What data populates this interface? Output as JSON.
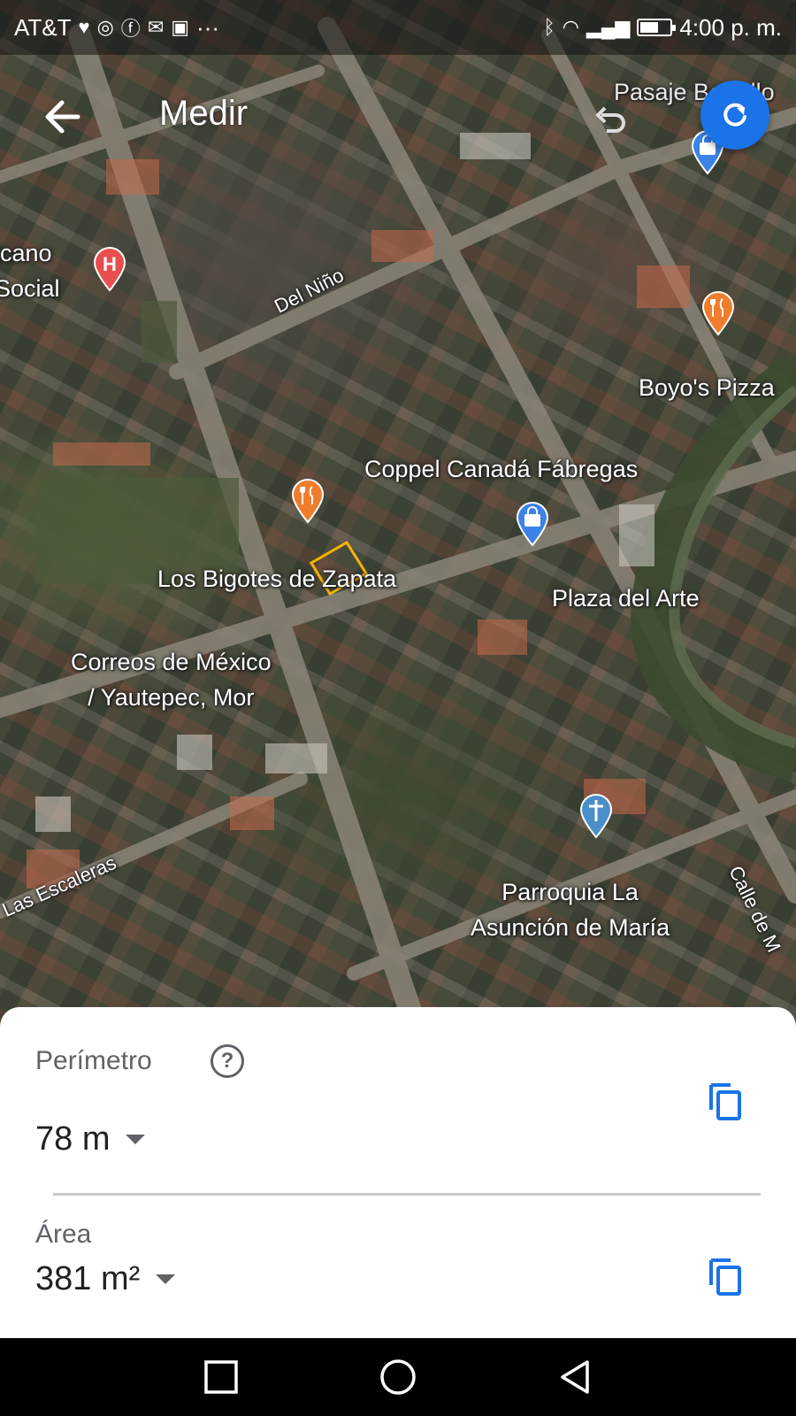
{
  "status_bar": {
    "carrier": "AT&T",
    "more": "···",
    "time": "4:00 p. m."
  },
  "app_bar": {
    "title": "Medir"
  },
  "map": {
    "places": [
      {
        "id": "hospital",
        "label_lines": [
          "icano",
          "Social"
        ],
        "icon": "hospital-pin-icon",
        "color": "#e94e4e"
      },
      {
        "id": "boyos",
        "label": "Boyo's Pizza",
        "icon": "restaurant-pin-icon",
        "color": "#f07d2c"
      },
      {
        "id": "coppel",
        "label": "Coppel Canadá Fábregas",
        "icon": "shopping-pin-icon",
        "color": "#3c82e8"
      },
      {
        "id": "bigotes",
        "label": "Los Bigotes de Zapata",
        "icon": "restaurant-pin-icon",
        "color": "#f07d2c"
      },
      {
        "id": "plaza",
        "label": "Plaza del Arte"
      },
      {
        "id": "correos",
        "label_lines": [
          "Correos de México",
          "/ Yautepec, Mor"
        ]
      },
      {
        "id": "parroquia",
        "label_lines": [
          "Parroquia La",
          "Asunción de María"
        ],
        "icon": "church-pin-icon",
        "color": "#4a8fc9"
      },
      {
        "id": "pasaje",
        "label": "Pasaje Bertello",
        "icon": "shopping-pin-icon",
        "color": "#3c82e8"
      }
    ],
    "streets": {
      "del_nino": "Del Niño",
      "las_escaleras": "Las Escaleras",
      "calle_de": "Calle de M"
    },
    "measured_shape_color": "#f4b400"
  },
  "measurement": {
    "perimeter_label": "Perímetro",
    "perimeter_value": "78 m",
    "area_label": "Área",
    "area_value": "381 m²",
    "accent_color": "#1a73e8"
  }
}
